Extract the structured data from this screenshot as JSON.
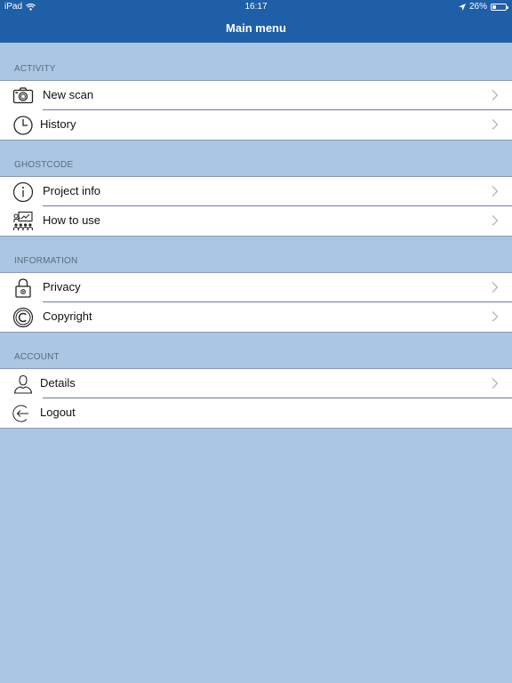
{
  "status": {
    "device": "iPad",
    "time": "16:17",
    "battery": "26%",
    "battery_level": 0.26
  },
  "nav": {
    "title": "Main menu"
  },
  "sections": [
    {
      "header": "ACTIVITY",
      "items": [
        {
          "label": "New scan",
          "icon": "camera-icon",
          "chevron": true
        },
        {
          "label": "History",
          "icon": "clock-icon",
          "chevron": true
        }
      ]
    },
    {
      "header": "GHOSTCODE",
      "items": [
        {
          "label": "Project info",
          "icon": "info-icon",
          "chevron": true
        },
        {
          "label": "How to use",
          "icon": "presentation-icon",
          "chevron": true
        }
      ]
    },
    {
      "header": "INFORMATION",
      "items": [
        {
          "label": "Privacy",
          "icon": "lock-icon",
          "chevron": true
        },
        {
          "label": "Copyright",
          "icon": "copyright-icon",
          "chevron": true
        }
      ]
    },
    {
      "header": "ACCOUNT",
      "items": [
        {
          "label": "Details",
          "icon": "user-icon",
          "chevron": true
        },
        {
          "label": "Logout",
          "icon": "logout-icon",
          "chevron": false
        }
      ]
    }
  ],
  "colors": {
    "nav_bar": "#1e5fa8",
    "background": "#aac6e2",
    "row_background": "#ffffff"
  }
}
